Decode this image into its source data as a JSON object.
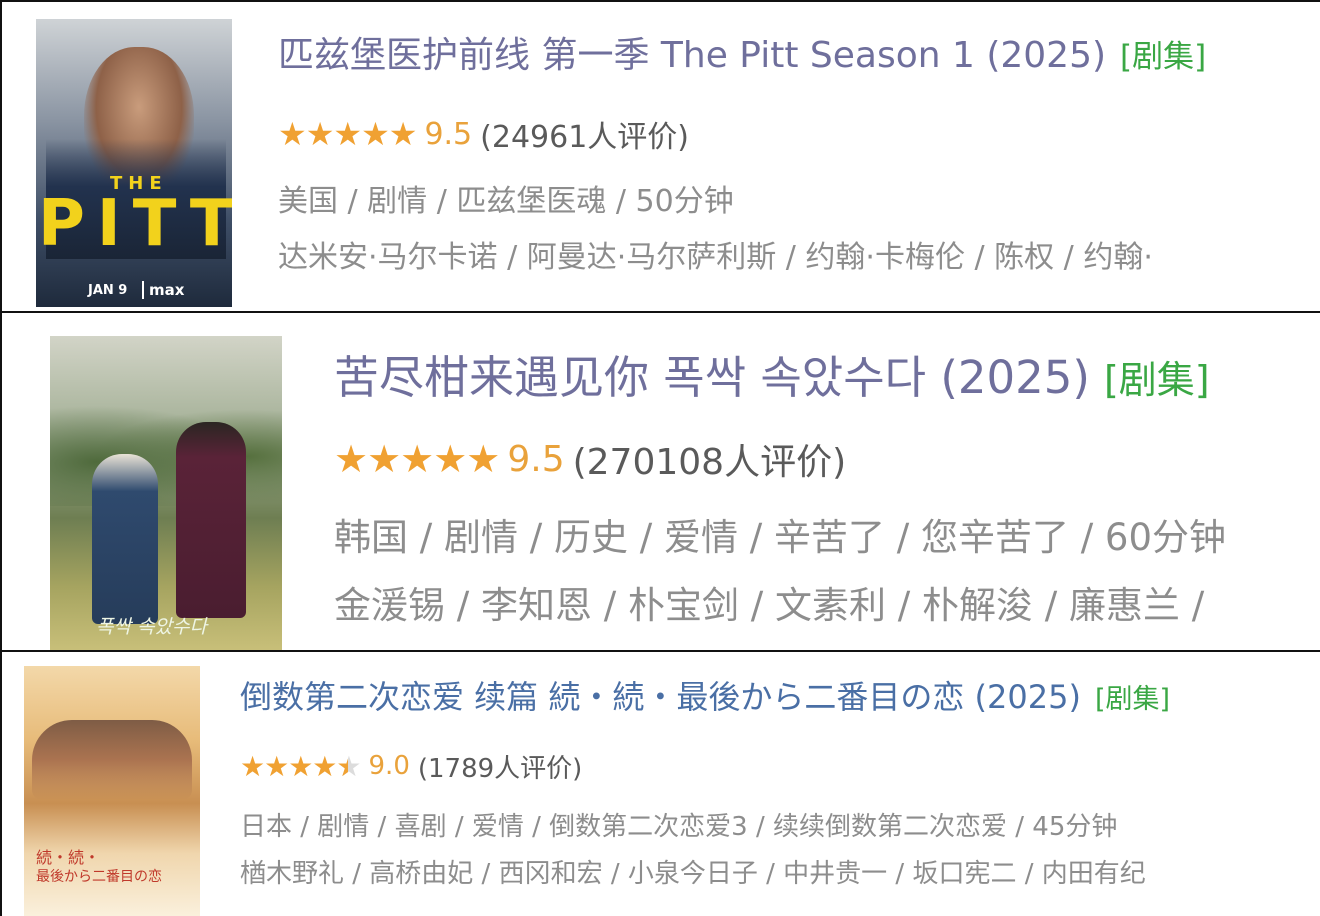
{
  "results": [
    {
      "title": "匹兹堡医护前线 第一季 The Pitt Season 1 (2025)",
      "tag": "[剧集]",
      "stars": "★★★★★",
      "score": "9.5",
      "count": "(24961人评价)",
      "meta": "美国 / 剧情 / 匹兹堡医魂 / 50分钟",
      "cast": "达米安·马尔卡诺 / 阿曼达·马尔萨利斯 / 约翰·卡梅伦 / 陈权 / 约翰·",
      "rating_fraction": 0.95,
      "poster": {
        "big_text": "PITT",
        "small_text": "THE",
        "date_text": "JAN 9",
        "brand_text": "max"
      }
    },
    {
      "title": "苦尽柑来遇见你 폭싹 속았수다 (2025)",
      "tag": "[剧集]",
      "stars": "★★★★★",
      "score": "9.5",
      "count": "(270108人评价)",
      "meta": "韩国 / 剧情 / 历史 / 爱情 / 辛苦了 / 您辛苦了 / 60分钟",
      "cast": "金湲锡 / 李知恩 / 朴宝剑 / 文素利 / 朴解浚 / 廉惠兰 / ",
      "rating_fraction": 0.95,
      "poster": {
        "caption": "폭싹 속았수다"
      }
    },
    {
      "title": "倒数第二次恋爱 续篇 続・続・最後から二番目の恋 (2025)",
      "tag": "[剧集]",
      "stars": "★★★★",
      "half_star": "★",
      "score": "9.0",
      "count": "(1789人评价)",
      "meta": "日本 / 剧情 / 喜剧 / 爱情 / 倒数第二次恋爱3 / 续续倒数第二次恋爱 / 45分钟",
      "cast": "楢木野礼 / 高桥由妃 / 西冈和宏 / 小泉今日子 / 中井贵一 / 坂口宪二 / 内田有纪",
      "rating_fraction": 0.9,
      "poster": {
        "caption_line1": "続・続・",
        "caption_line2": "最後から二番目の恋"
      }
    }
  ]
}
